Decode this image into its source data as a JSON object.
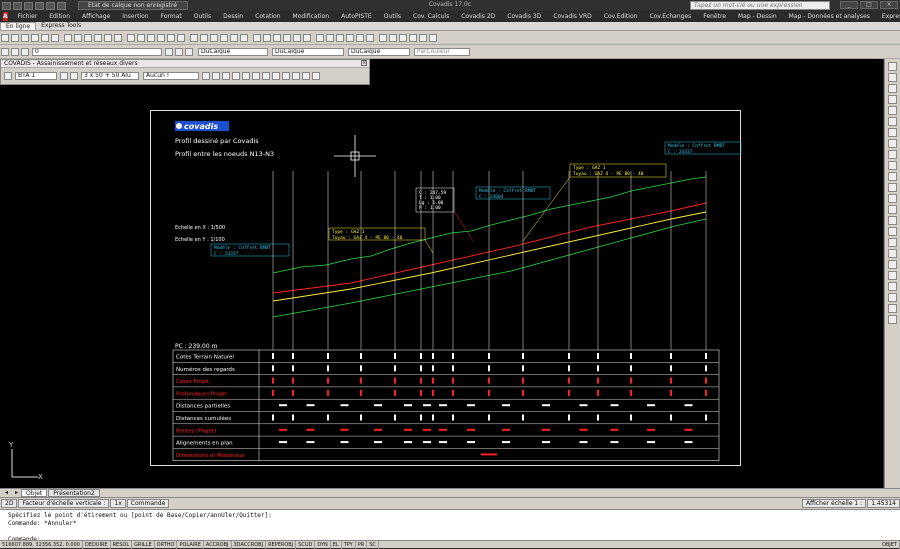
{
  "window": {
    "app_title": "Covadis 17.0c",
    "layer_state": "Etat de calque non enregistré",
    "search_placeholder": "Tapez un mot-clé ou une expression"
  },
  "menu": [
    "Fichier",
    "Edition",
    "Affichage",
    "Insertion",
    "Format",
    "Outils",
    "Dessin",
    "Cotation",
    "Modification",
    "AutoPISTE",
    "Outils",
    "Cov. Calculs",
    "Covadis 2D",
    "Covadis 3D",
    "Covadis VRD",
    "Cov.Edition",
    "Cov.Echanges",
    "Fenêtre",
    "Map - Dessin",
    "Map - Données et analyses",
    "Express"
  ],
  "ribbon_tabs": [
    "En ligne",
    "Express Tools"
  ],
  "toolbar2": {
    "layer": "0",
    "dislayer": "DuCalque",
    "linetype": "DuCalque",
    "lineweight": "DuCalque",
    "color": "ParCouleur"
  },
  "covadis_bar": {
    "title": "COVADIS - Assainissement et réseaux divers",
    "network": "BTA 1",
    "cable": "3 x 50 + 50 Alu",
    "option": "Aucun !"
  },
  "sheet": {
    "logo": "covadis",
    "title": "Profil dessiné par Covadis",
    "subtitle": "Profil entre les noeuds N13-N3",
    "scale_x": "Echelle en X : 1/500",
    "scale_y": "Echelle en Y : 1/100",
    "pc": "PC : 239.00 m",
    "rows": [
      {
        "label": "Cotes Terrain Naturel",
        "color": "#ffffff"
      },
      {
        "label": "Numéros des regards",
        "color": "#ffffff"
      },
      {
        "label": "Cotes Projet",
        "color": "#ff2020"
      },
      {
        "label": "Profondeurs Projet",
        "color": "#ff2020"
      },
      {
        "label": "Distances partielles",
        "color": "#ffffff"
      },
      {
        "label": "Distances cumulées",
        "color": "#ffffff"
      },
      {
        "label": "Pentes (Projet)",
        "color": "#ff2020"
      },
      {
        "label": "Alignements en plan",
        "color": "#ffffff"
      },
      {
        "label": "Dimensions et Matériaux",
        "color": "#ff2020"
      }
    ],
    "annotations": [
      {
        "text": "Modèle : Coffret RMBT\nC :            24337"
      },
      {
        "text": "Type :              GAZ 1\nTuyau : GAZ 4 - PE 80 - 40"
      },
      {
        "text": "C :   247.59\nT :    1.00\nLg :   1.00\nP :    1.00\nR :    1.00"
      },
      {
        "text": "Modèle : Coffret RMBT\nC :           24604"
      },
      {
        "text": "Type :              GAZ 1\nTuyau : GAZ 4 - PE 80 - 40"
      },
      {
        "text": "Modèle : Coffret RMBT\nC :           24337"
      }
    ]
  },
  "layout_tabs": [
    "Objet",
    "Présentation2"
  ],
  "status2": {
    "model": "2D",
    "scale_factor": "Facteur d'échelle verticale :",
    "scale_val": "1x",
    "cmd": "Commande",
    "show_scale": "Afficher échelle 1 :",
    "scale_num": "1.45314"
  },
  "cmdline": [
    "Spécifiez le point d'étirement ou [point de Base/Copier/annUler/Quitter]:",
    "Commande: *Annuler*",
    "",
    "Commande:"
  ],
  "status": {
    "coords": "516607.889, 32356.352, 0.000",
    "buttons": [
      "DEDUIRE",
      "RESOL",
      "GRILLE",
      "ORTHO",
      "POLAIRE",
      "ACCROBJ",
      "3DACCROBJ",
      "REPEROBJ",
      "SCUD",
      "DYN",
      "EL",
      "TPY",
      "PR",
      "SC"
    ],
    "right": "OBJET"
  }
}
